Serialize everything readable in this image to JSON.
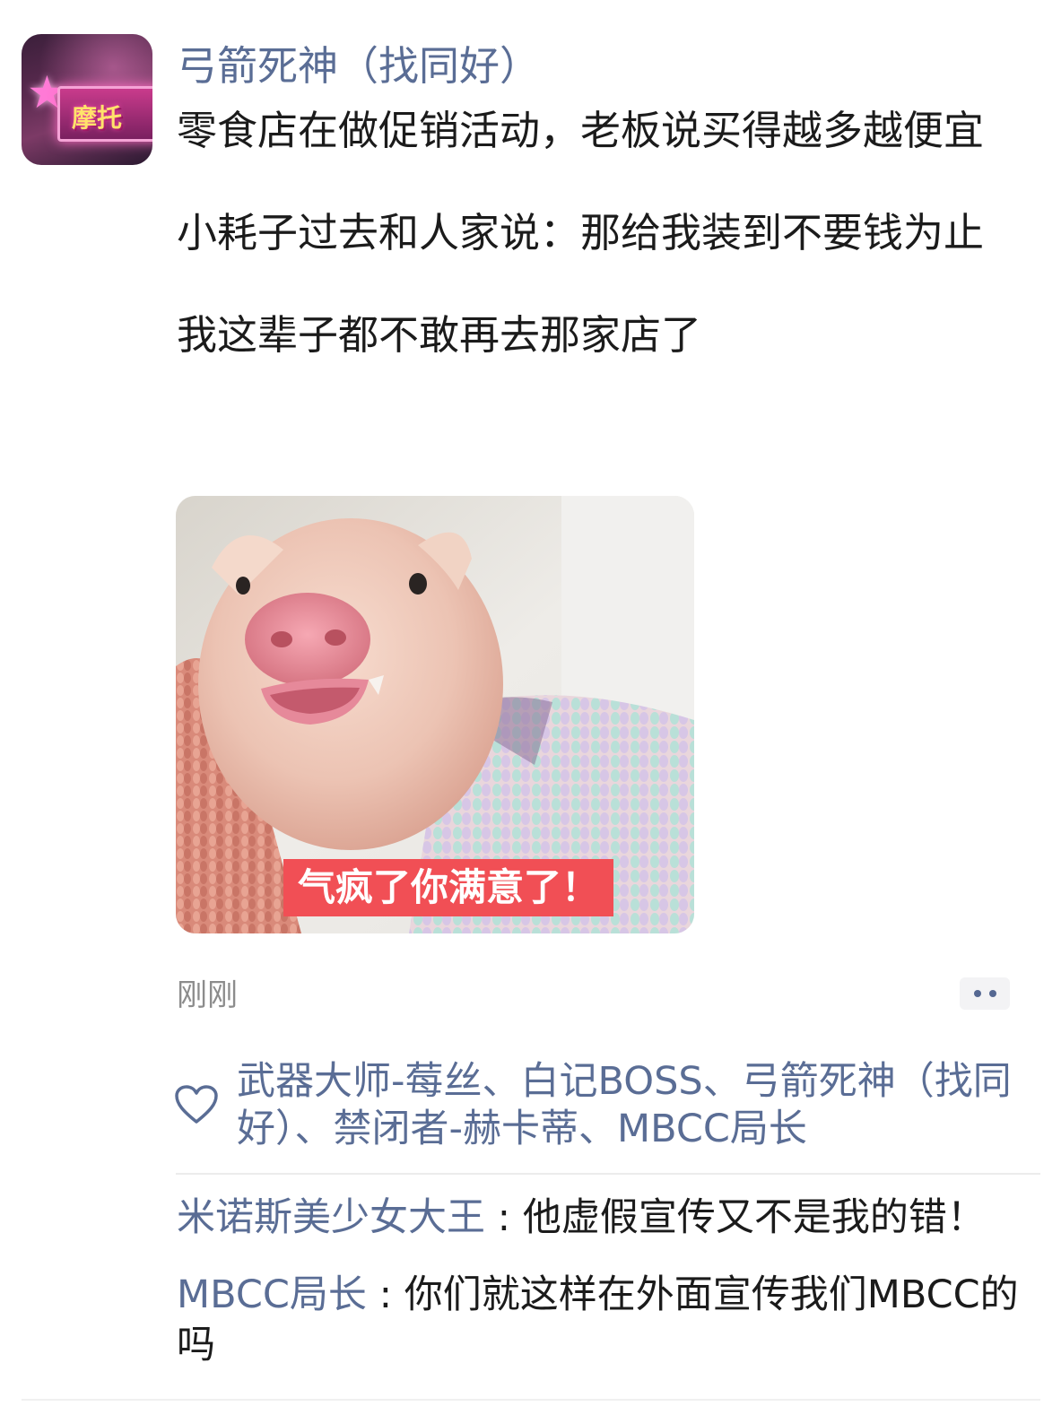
{
  "post": {
    "username": "弓箭死神（找同好）",
    "avatar_icon": "avatar-neon-sign",
    "avatar_text": "摩托",
    "paragraphs": [
      "零食店在做促销活动，老板说买得越多越便宜",
      "小耗子过去和人家说：那给我装到不要钱为止",
      "我这辈子都不敢再去那家店了"
    ],
    "image_caption": "气疯了你满意了！",
    "time": "刚刚",
    "more_icon": "more-dots-icon"
  },
  "likes": {
    "icon": "heart-icon",
    "text": "武器大师-莓丝、白记BOSS、弓箭死神（找同好）、禁闭者-赫卡蒂、MBCC局长"
  },
  "comments": [
    {
      "author": "米诺斯美少女大王",
      "sep": " : ",
      "text": "他虚假宣传又不是我的错！"
    },
    {
      "author": "MBCC局长",
      "sep": " : ",
      "text": "你们就这样在外面宣传我们MBCC的吗"
    }
  ],
  "colors": {
    "name": "#5a6d95",
    "text": "#1b1b1b",
    "meta": "#8c8c8c",
    "caption_bg": "#f14f55"
  }
}
